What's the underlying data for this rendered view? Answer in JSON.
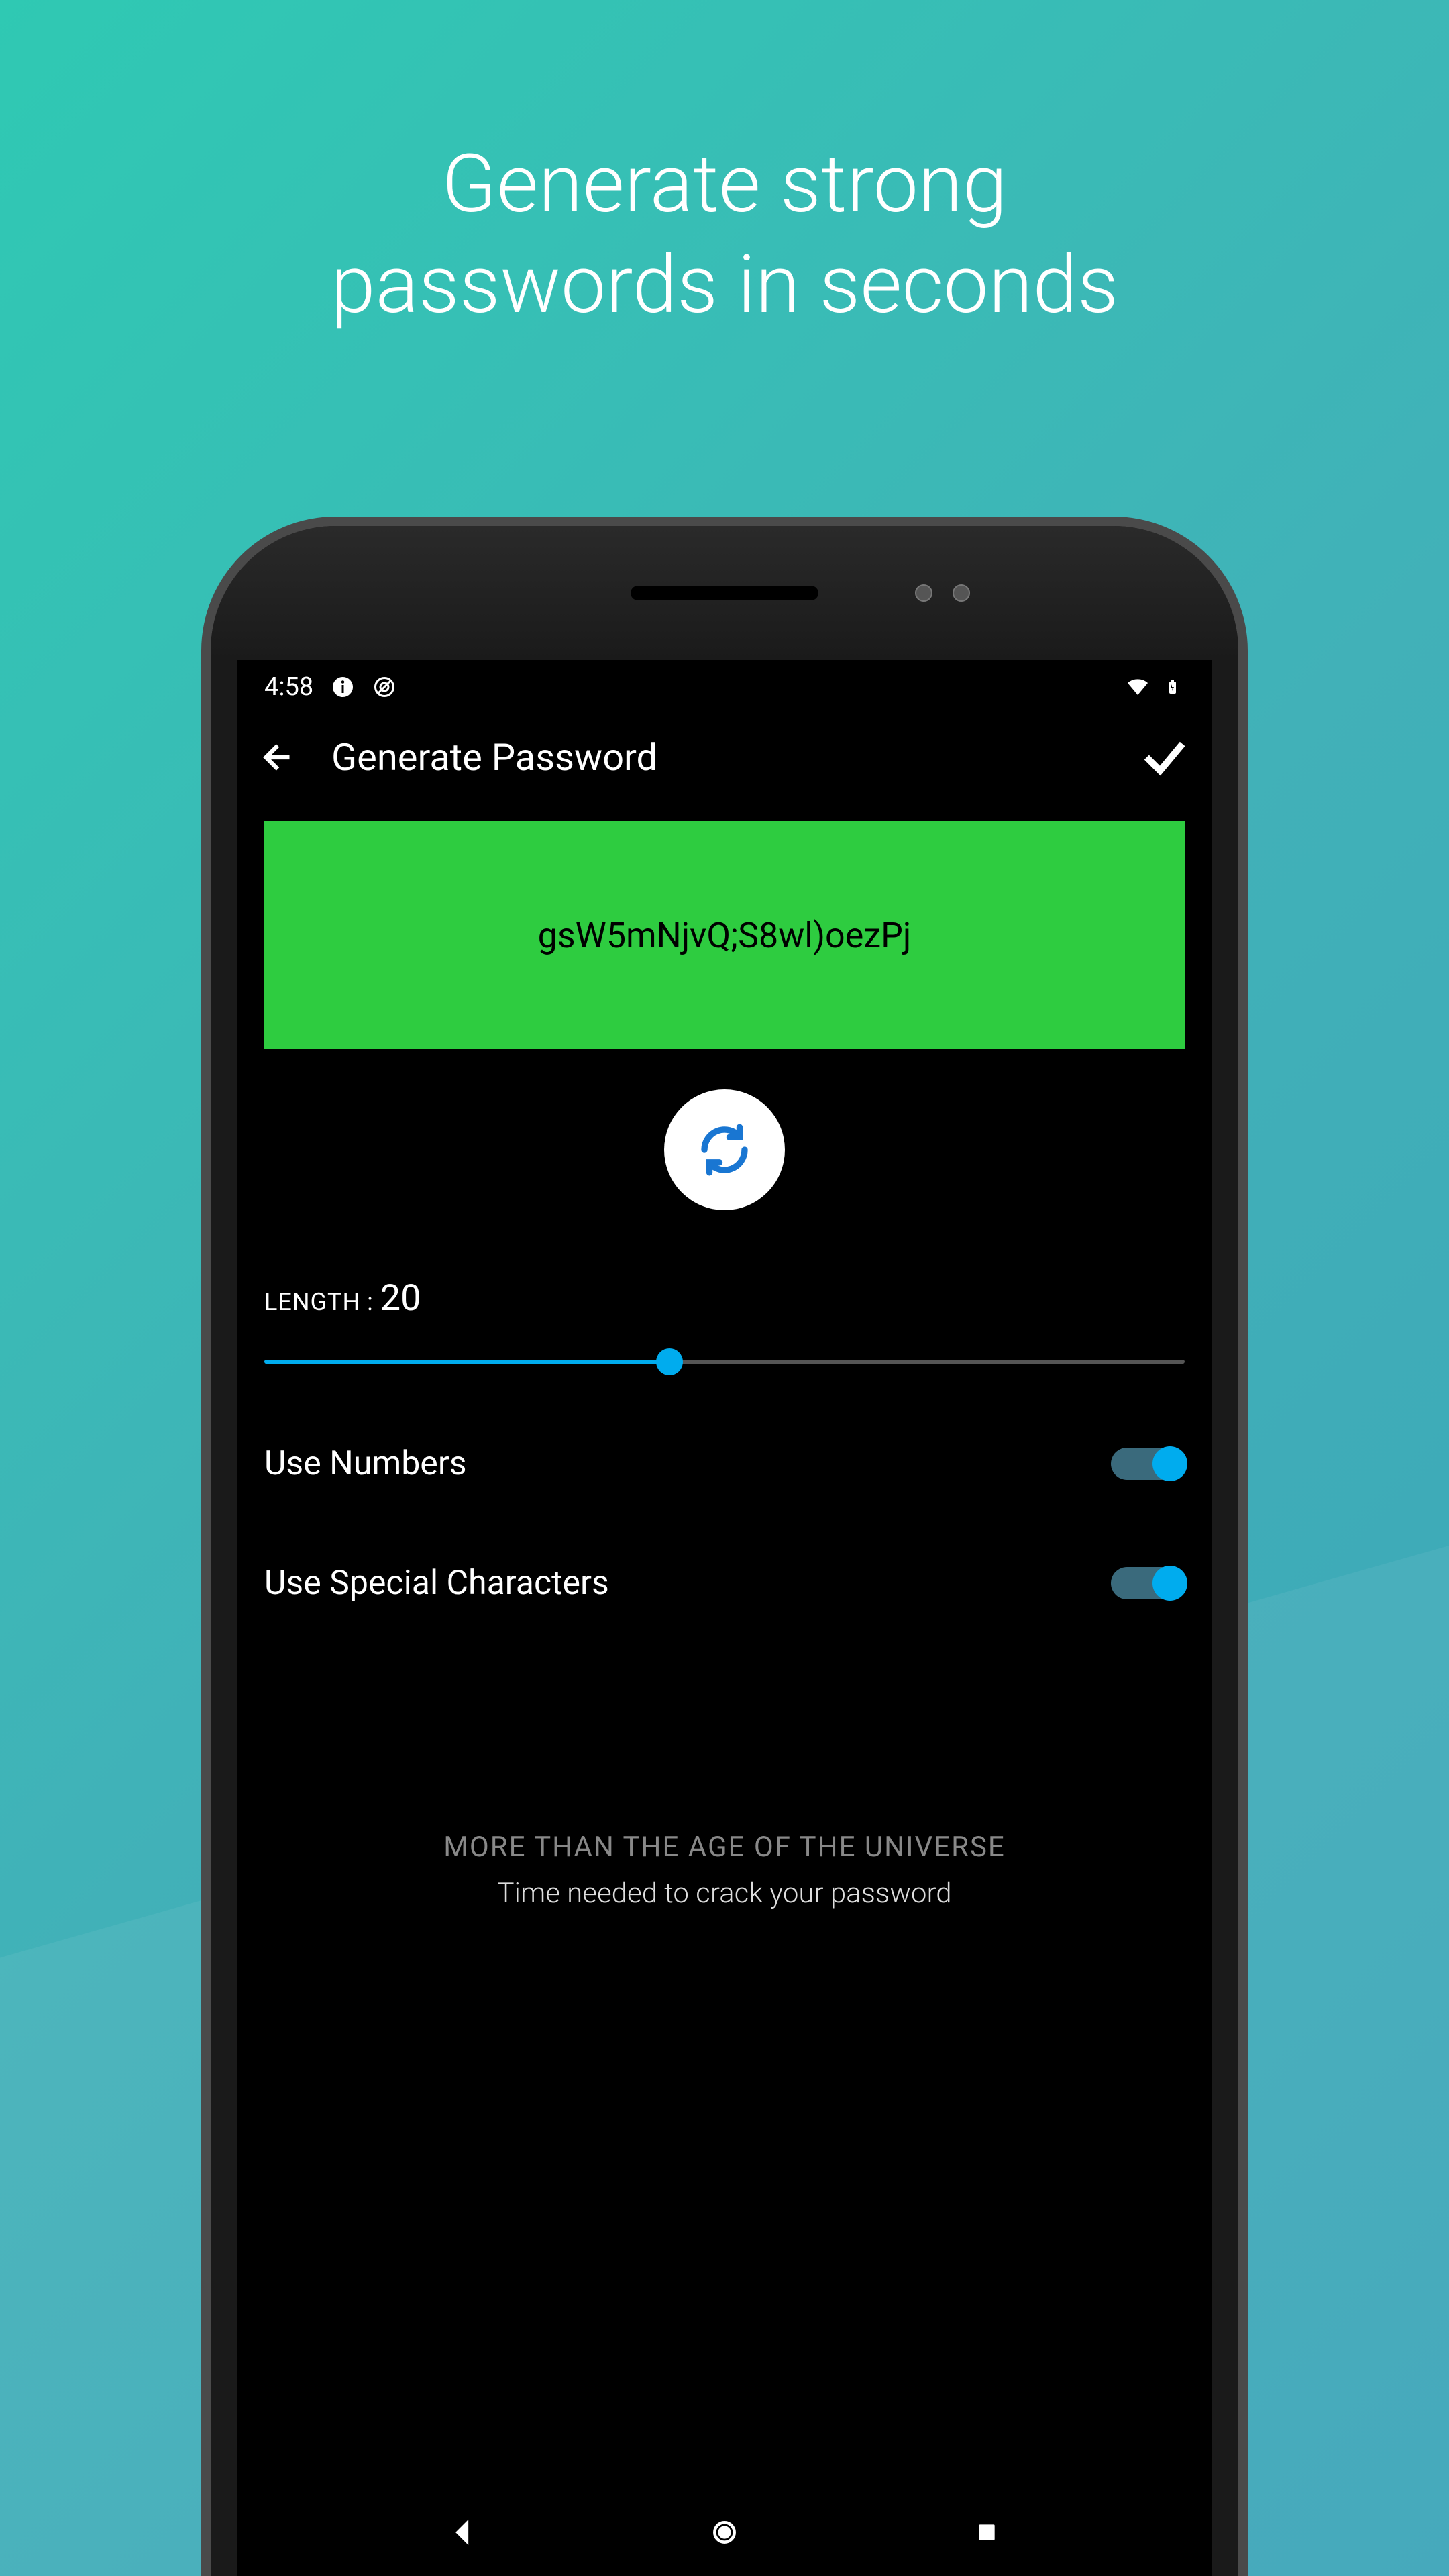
{
  "headline": {
    "line1": "Generate strong",
    "line2": "passwords in seconds"
  },
  "statusBar": {
    "time": "4:58"
  },
  "appBar": {
    "title": "Generate Password"
  },
  "password": {
    "generated": "gsW5mNjvQ;S8wl)oezPj"
  },
  "length": {
    "label": "LENGTH : ",
    "value": "20",
    "sliderPercent": 44
  },
  "options": {
    "useNumbers": {
      "label": "Use Numbers",
      "enabled": true
    },
    "useSpecialChars": {
      "label": "Use Special Characters",
      "enabled": true
    }
  },
  "strength": {
    "title": "MORE THAN THE AGE OF THE UNIVERSE",
    "subtitle": "Time needed to crack your password"
  },
  "colors": {
    "accent": "#00acee",
    "passwordBox": "#2ecc40"
  }
}
